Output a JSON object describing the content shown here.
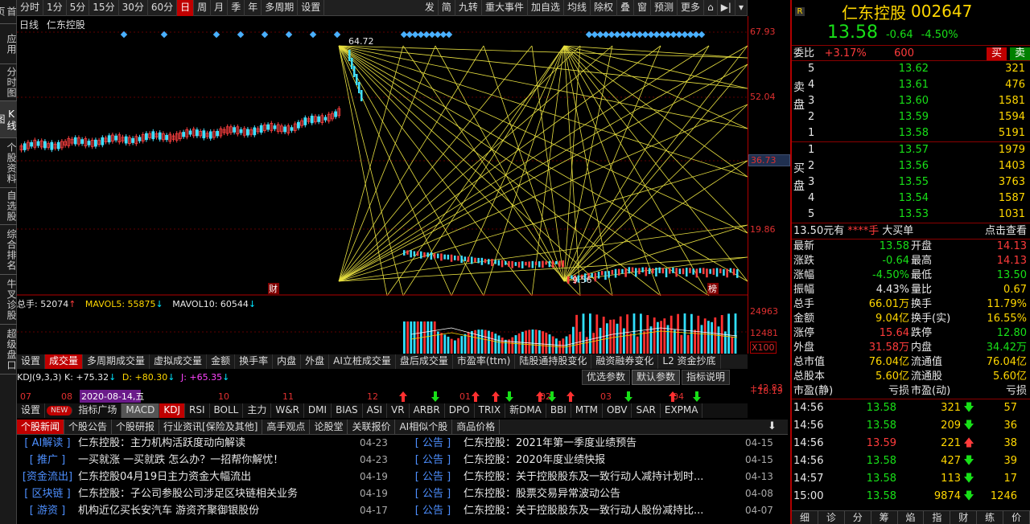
{
  "left_nav": [
    "首页",
    "应用",
    "分时图",
    "K线图",
    "个股资料",
    "自选股",
    "综合排名",
    "牛叉诊股",
    "超级盘口"
  ],
  "left_nav_active": 3,
  "toolbar": {
    "periods": [
      "分时",
      "1分",
      "5分",
      "15分",
      "30分",
      "60分",
      "日",
      "周",
      "月",
      "季",
      "年",
      "多周期",
      "设置"
    ],
    "active_period": "日",
    "right_items": [
      "发",
      "简",
      "九转",
      "重大事件",
      "加自选",
      "均线",
      "除权",
      "叠",
      "窗",
      "预测",
      "更多"
    ]
  },
  "chart": {
    "label_type": "日线",
    "label_name": "仁东控股",
    "high_label": "64.72",
    "low_label": "9.56",
    "event_label_1": "财",
    "event_label_2": "榜",
    "y_ticks": [
      "67.93",
      "52.04",
      "36.73",
      "19.86"
    ],
    "current_price_label": "36.73",
    "vol_ticks": [
      "24963",
      "12481",
      "X100"
    ]
  },
  "volume_header": {
    "total": "总手: 52074",
    "mavol5": "MAVOL5: 55875",
    "mavol10": "MAVOL10: 60544"
  },
  "indicator_tabs_1": [
    "设置",
    "成交量",
    "多周期成交量",
    "虚拟成交量",
    "金额",
    "换手率",
    "内盘",
    "外盘",
    "AI立桩成交量",
    "盘后成交量",
    "市盈率(ttm)",
    "陆股通持股变化",
    "融资融券变化",
    "L2 资金抄底"
  ],
  "indicator_tabs_1_active": "成交量",
  "kdj": {
    "label": "KDJ(9,3,3)",
    "k": "K: +75.32",
    "d": "D: +80.30",
    "j": "J: +65.35",
    "buttons": [
      "优选参数",
      "默认参数",
      "指标说明"
    ],
    "right_values": [
      "+42.83",
      "+18.19"
    ]
  },
  "date_axis": [
    "07",
    "08",
    "2020-08-14,五",
    "10",
    "11",
    "12",
    "01",
    "02",
    "03",
    "04"
  ],
  "indicator_tabs_2": [
    "设置",
    "NEW",
    "指标广场",
    "MACD",
    "KDJ",
    "RSI",
    "BOLL",
    "主力",
    "W&R",
    "DMI",
    "BIAS",
    "ASI",
    "VR",
    "ARBR",
    "DPO",
    "TRIX",
    "新DMA",
    "BBI",
    "MTM",
    "OBV",
    "SAR",
    "EXPMA"
  ],
  "indicator_tabs_2_active": "KDJ",
  "news_tabs": [
    "个股新闻",
    "个股公告",
    "个股研报",
    "行业资讯[保险及其他]",
    "高手观点",
    "论股堂",
    "关联报价",
    "AI相似个股",
    "商品价格"
  ],
  "news_tabs_active": "个股新闻",
  "news_left": [
    {
      "tag": "[ AI解读 ]",
      "title": "仁东控股：主力机构活跃度动向解读",
      "date": "04-23"
    },
    {
      "tag": "[  推广  ]",
      "title": "一买就涨 一买就跌 怎么办？一招帮你解忧！",
      "date": "04-23"
    },
    {
      "tag": "[资金流出]",
      "title": "仁东控股04月19日主力资金大幅流出",
      "date": "04-19"
    },
    {
      "tag": "[ 区块链 ]",
      "title": "仁东控股：子公司参股公司涉足区块链相关业务",
      "date": "04-19"
    },
    {
      "tag": "[  游资  ]",
      "title": "机构近亿买长安汽车 游资齐聚御银股份",
      "date": "04-17"
    }
  ],
  "news_right": [
    {
      "tag": "[  公告  ]",
      "title": "仁东控股：2021年第一季度业绩预告",
      "date": "04-15"
    },
    {
      "tag": "[  公告  ]",
      "title": "仁东控股：2020年度业绩快报",
      "date": "04-15"
    },
    {
      "tag": "[  公告  ]",
      "title": "仁东控股：关于控股股东及一致行动人减持计划时...",
      "date": "04-13"
    },
    {
      "tag": "[  公告  ]",
      "title": "仁东控股：股票交易异常波动公告",
      "date": "04-08"
    },
    {
      "tag": "[  公告  ]",
      "title": "仁东控股：关于控股股东及一致行动人股份减持比...",
      "date": "04-07"
    }
  ],
  "quote": {
    "badge": "R",
    "name": "仁东控股",
    "code": "002647",
    "price": "13.58",
    "change": "-0.64",
    "pct": "-4.50%",
    "weibi_label": "委比",
    "weibi": "+3.17%",
    "weicha": "600",
    "buy_btn": "买",
    "sell_btn": "卖",
    "sell_label": "卖盘",
    "buy_label": "买盘",
    "asks": [
      {
        "lvl": "5",
        "price": "13.62",
        "vol": "321"
      },
      {
        "lvl": "4",
        "price": "13.61",
        "vol": "476"
      },
      {
        "lvl": "3",
        "price": "13.60",
        "vol": "1581"
      },
      {
        "lvl": "2",
        "price": "13.59",
        "vol": "1594"
      },
      {
        "lvl": "1",
        "price": "13.58",
        "vol": "5191"
      }
    ],
    "bids": [
      {
        "lvl": "1",
        "price": "13.57",
        "vol": "1979"
      },
      {
        "lvl": "2",
        "price": "13.56",
        "vol": "1403"
      },
      {
        "lvl": "3",
        "price": "13.55",
        "vol": "3763"
      },
      {
        "lvl": "4",
        "price": "13.54",
        "vol": "1587"
      },
      {
        "lvl": "5",
        "price": "13.53",
        "vol": "1031"
      }
    ],
    "bigorder": {
      "a": "13.50元有",
      "b": "****手",
      "c": "大买单",
      "d": "点击查看"
    },
    "stats": [
      {
        "l1": "最新",
        "v1": "13.58",
        "c1": "green",
        "l2": "开盘",
        "v2": "14.13",
        "c2": "red"
      },
      {
        "l1": "涨跌",
        "v1": "-0.64",
        "c1": "green",
        "l2": "最高",
        "v2": "14.13",
        "c2": "red"
      },
      {
        "l1": "涨幅",
        "v1": "-4.50%",
        "c1": "green",
        "l2": "最低",
        "v2": "13.50",
        "c2": "green"
      },
      {
        "l1": "振幅",
        "v1": "4.43%",
        "c1": "white",
        "l2": "量比",
        "v2": "0.67",
        "c2": "yellow"
      },
      {
        "l1": "总手",
        "v1": "66.01万",
        "c1": "yellow",
        "l2": "换手",
        "v2": "11.79%",
        "c2": "yellow"
      },
      {
        "l1": "金额",
        "v1": "9.04亿",
        "c1": "yellow",
        "l2": "换手(实)",
        "v2": "16.55%",
        "c2": "yellow"
      },
      {
        "l1": "涨停",
        "v1": "15.64",
        "c1": "red",
        "l2": "跌停",
        "v2": "12.80",
        "c2": "green"
      },
      {
        "l1": "外盘",
        "v1": "31.58万",
        "c1": "red",
        "l2": "内盘",
        "v2": "34.42万",
        "c2": "green"
      },
      {
        "l1": "总市值",
        "v1": "76.04亿",
        "c1": "yellow",
        "l2": "流通值",
        "v2": "76.04亿",
        "c2": "yellow"
      },
      {
        "l1": "总股本",
        "v1": "5.60亿",
        "c1": "yellow",
        "l2": "流通股",
        "v2": "5.60亿",
        "c2": "yellow"
      },
      {
        "l1": "市盈(静)",
        "v1": "亏损",
        "c1": "white",
        "l2": "市盈(动)",
        "v2": "亏损",
        "c2": "white"
      }
    ],
    "ticks": [
      {
        "time": "14:56",
        "price": "13.58",
        "vol": "321",
        "dir": "down",
        "n": "57"
      },
      {
        "time": "14:56",
        "price": "13.58",
        "vol": "209",
        "dir": "down",
        "n": "36"
      },
      {
        "time": "14:56",
        "price": "13.59",
        "vol": "221",
        "dir": "up",
        "n": "38"
      },
      {
        "time": "14:56",
        "price": "13.58",
        "vol": "427",
        "dir": "down",
        "n": "39"
      },
      {
        "time": "14:57",
        "price": "13.58",
        "vol": "113",
        "dir": "down",
        "n": "17"
      },
      {
        "time": "15:00",
        "price": "13.58",
        "vol": "9874",
        "dir": "down",
        "n": "1246"
      }
    ],
    "bottom_tabs": [
      "细",
      "诊",
      "分",
      "筹",
      "焰",
      "指",
      "财",
      "练",
      "价"
    ]
  }
}
